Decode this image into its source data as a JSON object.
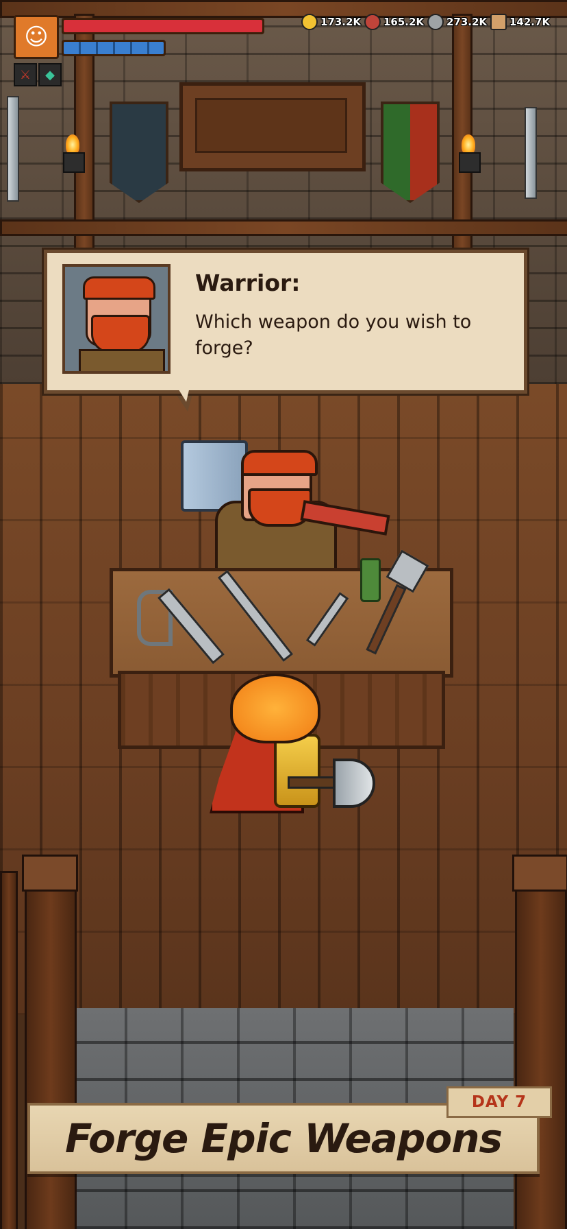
{
  "hud": {
    "avatar_icon": "hero-portrait-icon",
    "health_fraction": 1.0,
    "mana_fraction": 1.0,
    "skills": [
      {
        "icon": "sword-skill-icon",
        "glyph": "⚔"
      },
      {
        "icon": "gem-skill-icon",
        "glyph": "◆"
      }
    ],
    "resources": [
      {
        "icon": "gold-coin-icon",
        "color": "#f2c232",
        "value": "173.2K"
      },
      {
        "icon": "meat-icon",
        "color": "#c0443a",
        "value": "165.2K"
      },
      {
        "icon": "stone-icon",
        "color": "#9ea3a6",
        "value": "273.2K"
      },
      {
        "icon": "wood-log-icon",
        "color": "#d2a06a",
        "value": "142.7K"
      }
    ]
  },
  "dialog": {
    "speaker": "Warrior:",
    "text": "Which weapon do you wish to forge?"
  },
  "banner": {
    "title": "Forge Epic Weapons",
    "day": "DAY 7"
  },
  "colors": {
    "health": "#d8303a",
    "mana": "#3a7fd0",
    "accent": "#b5341a"
  }
}
